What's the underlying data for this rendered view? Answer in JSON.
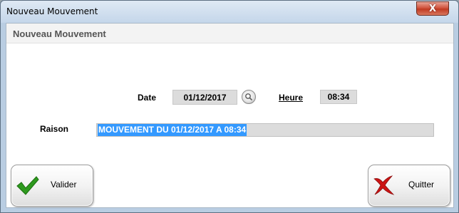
{
  "window": {
    "title": "Nouveau Mouvement",
    "close_label": "X"
  },
  "form": {
    "heading": "Nouveau Mouvement",
    "date_label": "Date",
    "date_value": "01/12/2017",
    "heure_label": "Heure",
    "heure_value": "08:34",
    "raison_label": "Raison",
    "raison_value": "MOUVEMENT DU 01/12/2017 A 08:34"
  },
  "buttons": {
    "validate_label": "Valider",
    "quit_label": "Quitter"
  },
  "icons": {
    "validate": "checkmark-icon",
    "quit": "cross-icon",
    "search": "magnifier-icon"
  },
  "colors": {
    "selection": "#3399ff",
    "check_green": "#2e9a1e",
    "cross_red": "#cc1414"
  }
}
